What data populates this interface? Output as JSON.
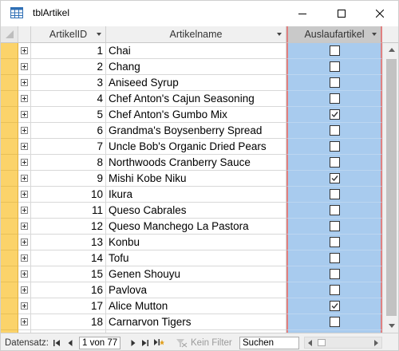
{
  "window": {
    "title": "tblArtikel"
  },
  "columns": {
    "id": "ArtikelID",
    "name": "Artikelname",
    "flag": "Auslaufartikel"
  },
  "rows": [
    {
      "id": "1",
      "name": "Chai",
      "discontinued": false
    },
    {
      "id": "2",
      "name": "Chang",
      "discontinued": false
    },
    {
      "id": "3",
      "name": "Aniseed Syrup",
      "discontinued": false
    },
    {
      "id": "4",
      "name": "Chef Anton's Cajun Seasoning",
      "discontinued": false
    },
    {
      "id": "5",
      "name": "Chef Anton's Gumbo Mix",
      "discontinued": true
    },
    {
      "id": "6",
      "name": "Grandma's Boysenberry Spread",
      "discontinued": false
    },
    {
      "id": "7",
      "name": "Uncle Bob's Organic Dried Pears",
      "discontinued": false
    },
    {
      "id": "8",
      "name": "Northwoods Cranberry Sauce",
      "discontinued": false
    },
    {
      "id": "9",
      "name": "Mishi Kobe Niku",
      "discontinued": true
    },
    {
      "id": "10",
      "name": "Ikura",
      "discontinued": false
    },
    {
      "id": "11",
      "name": "Queso Cabrales",
      "discontinued": false
    },
    {
      "id": "12",
      "name": "Queso Manchego La Pastora",
      "discontinued": false
    },
    {
      "id": "13",
      "name": "Konbu",
      "discontinued": false
    },
    {
      "id": "14",
      "name": "Tofu",
      "discontinued": false
    },
    {
      "id": "15",
      "name": "Genen Shouyu",
      "discontinued": false
    },
    {
      "id": "16",
      "name": "Pavlova",
      "discontinued": false
    },
    {
      "id": "17",
      "name": "Alice Mutton",
      "discontinued": true
    },
    {
      "id": "18",
      "name": "Carnarvon Tigers",
      "discontinued": false
    },
    {
      "id": "",
      "name": "",
      "discontinued": false
    }
  ],
  "footer": {
    "label": "Datensatz:",
    "record": "1 von 77",
    "filter": "Kein Filter",
    "search": "Suchen"
  },
  "colors": {
    "selector": "#fbd36a",
    "selected_column": "#a8cbee",
    "column_border": "#e08080"
  },
  "icons": {
    "app": "table-icon",
    "minimize": "minimize-icon",
    "maximize": "maximize-icon",
    "close": "close-icon",
    "expand": "plus-icon"
  }
}
